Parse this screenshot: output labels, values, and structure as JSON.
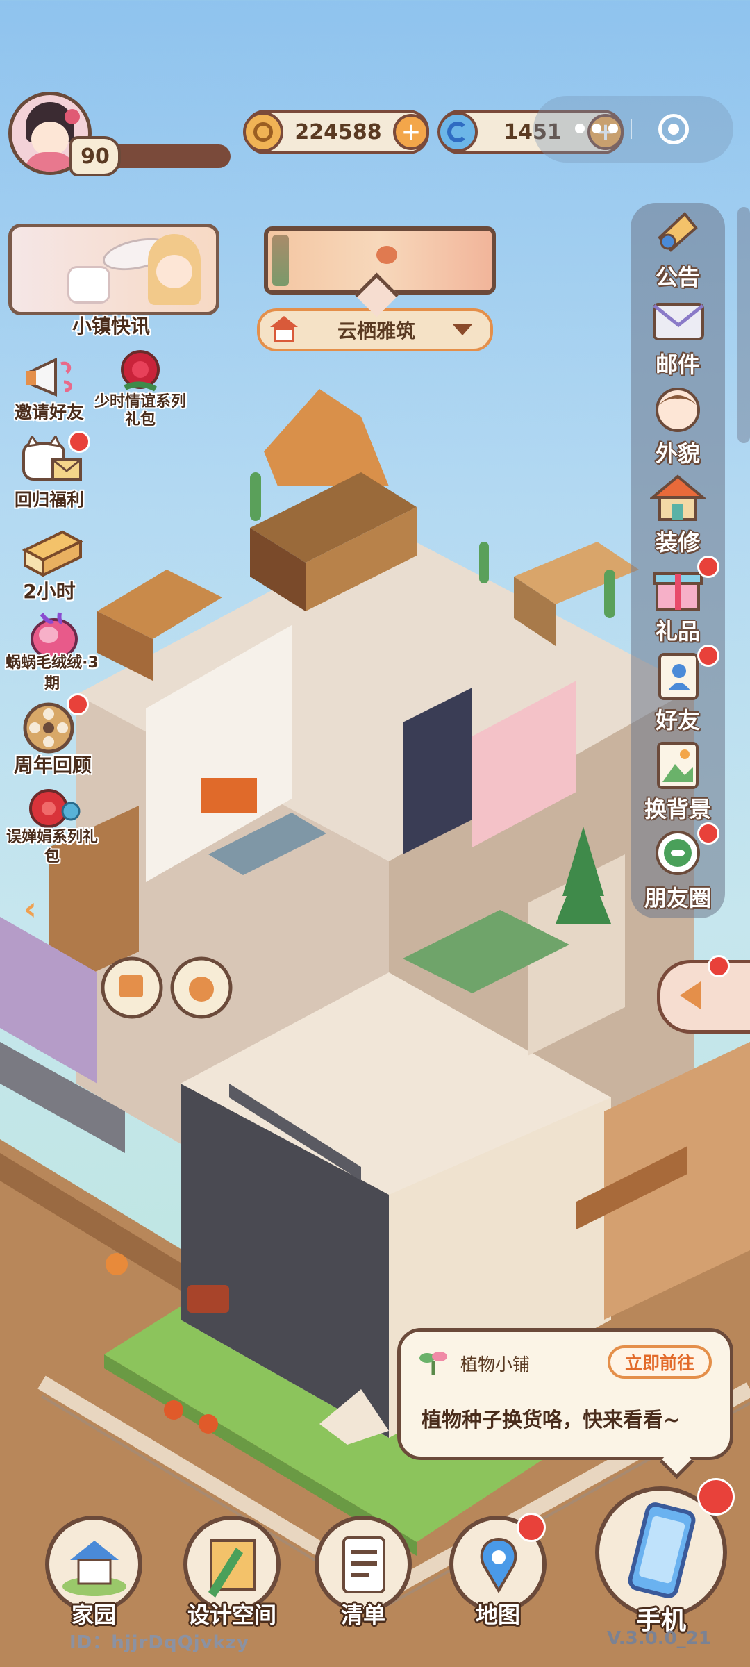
{
  "player": {
    "level": "90"
  },
  "currency": {
    "coins": "224588",
    "gems": "1451"
  },
  "news": {
    "label": "小镇快讯"
  },
  "location": {
    "name": "云栖雅筑"
  },
  "left_menu": {
    "invite": "邀请好友",
    "hourly_pack": "少时情谊系列礼包",
    "welcome_back": "回归福利",
    "timer": "2小时",
    "snail_event": "蜗蜗毛绒绒·3期",
    "anniversary": "周年回顾",
    "series_pack": "误婵娟系列礼包"
  },
  "right_menu": {
    "announce": "公告",
    "mail": "邮件",
    "appearance": "外貌",
    "decorate": "装修",
    "gift": "礼品",
    "friends": "好友",
    "background": "换背景",
    "moments": "朋友圈"
  },
  "notice": {
    "shop_name": "植物小铺",
    "go_button": "立即前往",
    "message": "植物种子换货咯，快来看看~"
  },
  "bottom_nav": {
    "home": "家园",
    "design": "设计空间",
    "list": "清单",
    "map": "地图",
    "phone": "手机"
  },
  "footer": {
    "id": "ID：hjjrDqQjvkzy",
    "version": "V.3.0.0_21"
  },
  "colors": {
    "accent": "#e48f4a",
    "outline": "#6b4a3a",
    "alert": "#e8413a"
  }
}
